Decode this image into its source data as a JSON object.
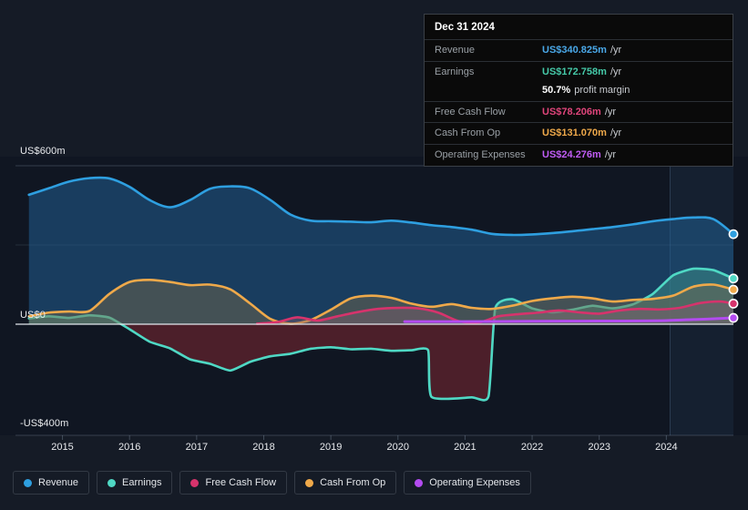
{
  "chart_data": {
    "type": "area",
    "title": "",
    "xlabel": "",
    "ylabel": "",
    "currency": "US$",
    "units": "m",
    "ylim": [
      -400,
      600
    ],
    "xlim": [
      2014.3,
      2025.0
    ],
    "grid": true,
    "legend_position": "bottom",
    "y_ticks": [
      {
        "value": 600,
        "label": "US$600m"
      },
      {
        "value": 0,
        "label": "US$0"
      },
      {
        "value": -400,
        "label": "-US$400m"
      }
    ],
    "x_ticks": [
      {
        "value": 2015,
        "label": "2015"
      },
      {
        "value": 2016,
        "label": "2016"
      },
      {
        "value": 2017,
        "label": "2017"
      },
      {
        "value": 2018,
        "label": "2018"
      },
      {
        "value": 2019,
        "label": "2019"
      },
      {
        "value": 2020,
        "label": "2020"
      },
      {
        "value": 2021,
        "label": "2021"
      },
      {
        "value": 2022,
        "label": "2022"
      },
      {
        "value": 2023,
        "label": "2023"
      },
      {
        "value": 2024,
        "label": "2024"
      }
    ],
    "forecast_start": 2024.3,
    "series": [
      {
        "name": "Revenue",
        "color": "#2e9fe0",
        "fill": "rgba(33,94,145,0.55)",
        "x": [
          2014.5,
          2014.8,
          2015.1,
          2015.4,
          2015.7,
          2016.0,
          2016.3,
          2016.6,
          2016.9,
          2017.2,
          2017.5,
          2017.8,
          2018.1,
          2018.4,
          2018.7,
          2019.0,
          2019.3,
          2019.6,
          2019.9,
          2020.2,
          2020.5,
          2020.8,
          2021.1,
          2021.4,
          2021.7,
          2022.0,
          2022.3,
          2022.6,
          2022.9,
          2023.2,
          2023.5,
          2023.8,
          2024.1,
          2024.4,
          2024.7,
          2025.0
        ],
        "values": [
          490,
          515,
          540,
          553,
          552,
          520,
          470,
          443,
          470,
          513,
          522,
          514,
          470,
          415,
          392,
          390,
          388,
          386,
          392,
          385,
          375,
          368,
          358,
          342,
          338,
          340,
          345,
          352,
          360,
          368,
          378,
          390,
          398,
          404,
          398,
          341
        ]
      },
      {
        "name": "Earnings",
        "color": "#4fd8c4",
        "fill_positive": "rgba(63,150,142,0.48)",
        "fill_negative": "rgba(102,36,46,0.70)",
        "x": [
          2014.5,
          2014.8,
          2015.1,
          2015.4,
          2015.7,
          2016.0,
          2016.3,
          2016.6,
          2016.9,
          2017.2,
          2017.5,
          2017.8,
          2018.1,
          2018.4,
          2018.7,
          2019.0,
          2019.3,
          2019.6,
          2019.9,
          2020.2,
          2020.45,
          2020.5,
          2021.1,
          2021.35,
          2021.45,
          2021.7,
          2022.0,
          2022.3,
          2022.6,
          2022.9,
          2023.2,
          2023.5,
          2023.8,
          2024.1,
          2024.4,
          2024.7,
          2025.0
        ],
        "values": [
          22,
          30,
          24,
          34,
          25,
          -20,
          -70,
          -96,
          -140,
          -158,
          -185,
          -150,
          -128,
          -118,
          -98,
          -92,
          -100,
          -98,
          -106,
          -104,
          -104,
          -290,
          -292,
          -288,
          60,
          95,
          60,
          45,
          55,
          70,
          60,
          75,
          115,
          185,
          210,
          205,
          173
        ]
      },
      {
        "name": "Free Cash Flow",
        "color": "#d6336c",
        "fill": "rgba(128,96,110,0.42)",
        "x": [
          2017.9,
          2018.2,
          2018.5,
          2018.8,
          2019.1,
          2019.4,
          2019.7,
          2020.0,
          2020.3,
          2020.6,
          2020.9,
          2021.2,
          2021.5,
          2021.8,
          2022.1,
          2022.4,
          2022.7,
          2023.0,
          2023.3,
          2023.6,
          2023.9,
          2024.2,
          2024.5,
          2024.8,
          2025.0
        ],
        "values": [
          2,
          8,
          26,
          14,
          30,
          46,
          58,
          62,
          60,
          44,
          12,
          6,
          30,
          38,
          44,
          52,
          45,
          40,
          52,
          58,
          56,
          62,
          80,
          86,
          78
        ]
      },
      {
        "name": "Cash From Op",
        "color": "#efa94a",
        "fill": "rgba(122,106,74,0.45)",
        "x": [
          2014.5,
          2014.8,
          2015.1,
          2015.4,
          2015.7,
          2016.0,
          2016.3,
          2016.6,
          2016.9,
          2017.2,
          2017.5,
          2017.8,
          2018.1,
          2018.4,
          2018.7,
          2019.0,
          2019.3,
          2019.6,
          2019.9,
          2020.2,
          2020.5,
          2020.8,
          2021.1,
          2021.4,
          2021.7,
          2022.0,
          2022.3,
          2022.6,
          2022.9,
          2023.2,
          2023.5,
          2023.8,
          2024.1,
          2024.4,
          2024.7,
          2025.0
        ],
        "values": [
          30,
          44,
          48,
          50,
          115,
          160,
          168,
          160,
          148,
          150,
          132,
          78,
          20,
          2,
          16,
          55,
          98,
          108,
          100,
          78,
          66,
          76,
          62,
          58,
          70,
          88,
          98,
          104,
          98,
          86,
          92,
          96,
          108,
          142,
          150,
          131
        ]
      },
      {
        "name": "Operating Expenses",
        "color": "#b34bf0",
        "x": [
          2020.1,
          2021.0,
          2022.0,
          2023.0,
          2024.0,
          2025.0
        ],
        "values": [
          10,
          10,
          11,
          12,
          14,
          24
        ]
      }
    ]
  },
  "tooltip": {
    "title": "Dec 31 2024",
    "rows": [
      {
        "label": "Revenue",
        "value": "US$340.825m",
        "unit": "/yr",
        "color": "#4aa8e8"
      },
      {
        "label": "Earnings",
        "value": "US$172.758m",
        "unit": "/yr",
        "color": "#45c9a8"
      },
      {
        "label": "Free Cash Flow",
        "value": "US$78.206m",
        "unit": "/yr",
        "color": "#e0457b"
      },
      {
        "label": "Cash From Op",
        "value": "US$131.070m",
        "unit": "/yr",
        "color": "#efa94a"
      },
      {
        "label": "Operating Expenses",
        "value": "US$24.276m",
        "unit": "/yr",
        "color": "#c05cf5"
      }
    ],
    "margin_value": "50.7%",
    "margin_text": "profit margin"
  },
  "legend": {
    "items": [
      {
        "label": "Revenue",
        "color": "#2e9fe0"
      },
      {
        "label": "Earnings",
        "color": "#4fd8c4"
      },
      {
        "label": "Free Cash Flow",
        "color": "#d6336c"
      },
      {
        "label": "Cash From Op",
        "color": "#efa94a"
      },
      {
        "label": "Operating Expenses",
        "color": "#b34bf0"
      }
    ]
  }
}
